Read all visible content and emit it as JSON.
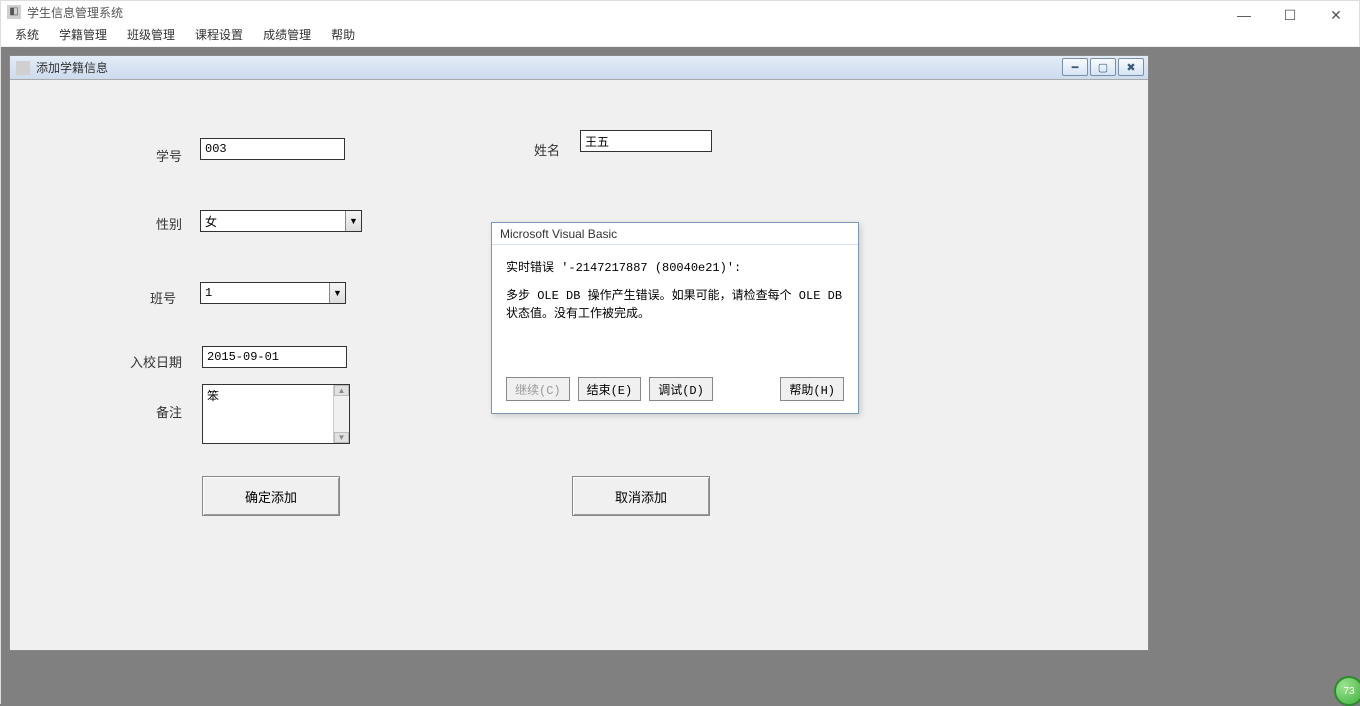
{
  "app": {
    "title": "学生信息管理系统"
  },
  "menu": {
    "items": [
      "系统",
      "学籍管理",
      "班级管理",
      "课程设置",
      "成绩管理",
      "帮助"
    ]
  },
  "child": {
    "title": "添加学籍信息"
  },
  "form": {
    "labels": {
      "sid": "学号",
      "name": "姓名",
      "gender": "性别",
      "class_no": "班号",
      "enroll_date": "入校日期",
      "remark": "备注"
    },
    "values": {
      "sid": "003",
      "name": "王五",
      "gender": "女",
      "class_no": "1",
      "enroll_date": "2015-09-01",
      "remark": "笨"
    },
    "buttons": {
      "confirm": "确定添加",
      "cancel": "取消添加"
    }
  },
  "error": {
    "title": "Microsoft Visual Basic",
    "line1": "实时错误 '-2147217887 (80040e21)':",
    "line2": "多步 OLE DB 操作产生错误。如果可能，请检查每个 OLE DB 状态值。没有工作被完成。",
    "buttons": {
      "continue": "继续(C)",
      "end": "结束(E)",
      "debug": "调试(D)",
      "help": "帮助(H)"
    }
  },
  "badge": {
    "text": "73"
  }
}
